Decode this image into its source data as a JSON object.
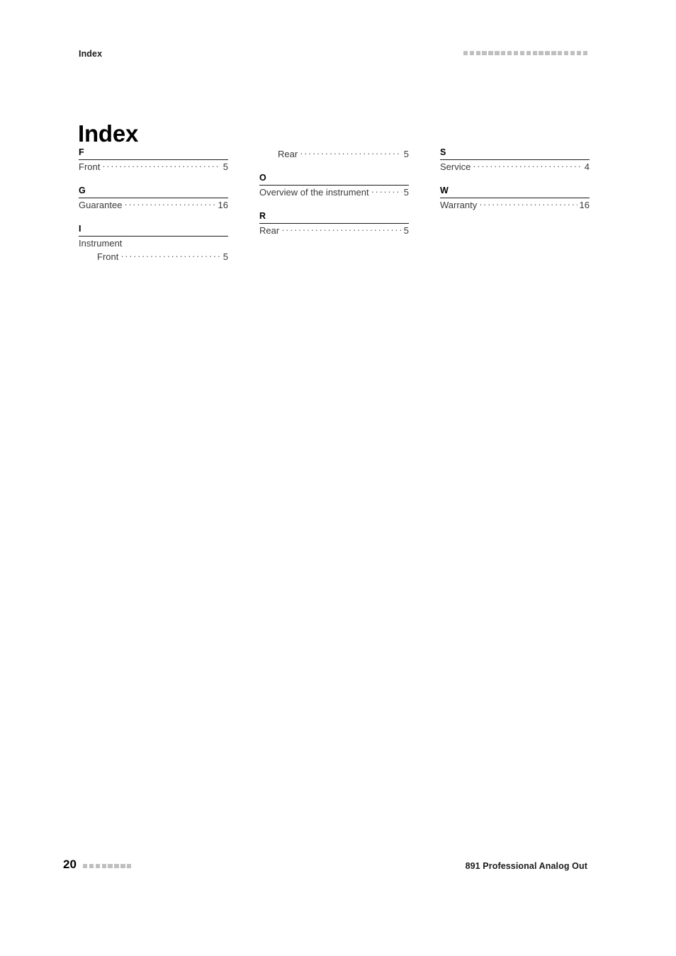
{
  "header": {
    "title": "Index",
    "marker_squares": 20,
    "marker_color": "#bfbfbf"
  },
  "title": "Index",
  "index": {
    "leader_char": "·",
    "columns": [
      {
        "groups": [
          {
            "letter": "F",
            "entries": [
              {
                "label": "Front",
                "page": "5",
                "level": 0
              }
            ]
          },
          {
            "letter": "G",
            "entries": [
              {
                "label": "Guarantee",
                "page": "16",
                "level": 0
              }
            ]
          },
          {
            "letter": "I",
            "entries": [
              {
                "label": "Instrument",
                "page": "",
                "level": 0
              },
              {
                "label": "Front",
                "page": "5",
                "level": 1
              }
            ]
          }
        ]
      },
      {
        "continuation": [
          {
            "label": "Rear",
            "page": "5",
            "level": 1
          }
        ],
        "groups": [
          {
            "letter": "O",
            "entries": [
              {
                "label": "Overview of the instrument",
                "page": "5",
                "level": 0
              }
            ]
          },
          {
            "letter": "R",
            "entries": [
              {
                "label": "Rear",
                "page": "5",
                "level": 0
              }
            ]
          }
        ]
      },
      {
        "groups": [
          {
            "letter": "S",
            "entries": [
              {
                "label": "Service",
                "page": "4",
                "level": 0
              }
            ]
          },
          {
            "letter": "W",
            "entries": [
              {
                "label": "Warranty",
                "page": "16",
                "level": 0
              }
            ]
          }
        ]
      }
    ]
  },
  "footer": {
    "folio": "20",
    "marker_squares": 8,
    "marker_color": "#bfbfbf",
    "product": "891 Professional Analog Out"
  }
}
